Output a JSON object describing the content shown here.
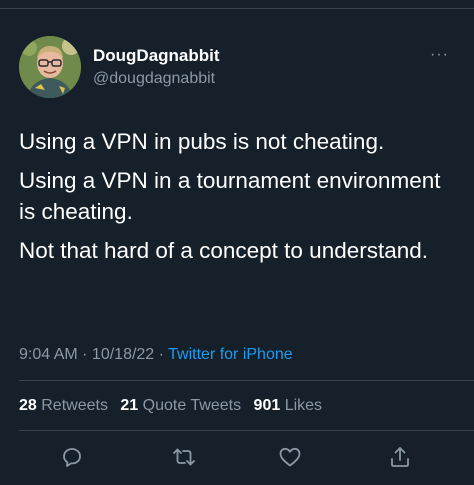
{
  "user": {
    "display_name": "DougDagnabbit",
    "handle": "@dougdagnabbit"
  },
  "tweet": {
    "paragraphs": [
      "Using a VPN in pubs is not cheating.",
      "Using a VPN in a tournament environment is cheating.",
      "Not that hard of a concept to understand."
    ]
  },
  "meta": {
    "time": "9:04 AM",
    "separator1": " · ",
    "date": "10/18/22",
    "separator2": " · ",
    "source": "Twitter for iPhone"
  },
  "stats": {
    "retweets_count": "28",
    "retweets_label": "Retweets",
    "quotes_count": "21",
    "quotes_label": "Quote Tweets",
    "likes_count": "901",
    "likes_label": "Likes"
  },
  "more_glyph": "···",
  "icons": {
    "reply": "reply-icon",
    "retweet": "retweet-icon",
    "like": "heart-icon",
    "share": "share-icon"
  },
  "colors": {
    "background": "#15202b",
    "text": "#ffffff",
    "secondary": "#8b98a5",
    "link": "#1d9bf0",
    "divider": "#38444d"
  }
}
